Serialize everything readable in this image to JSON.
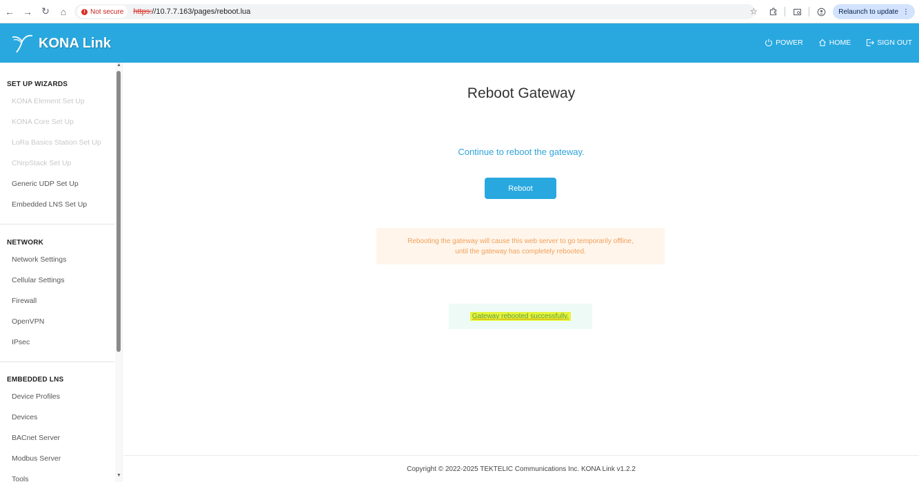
{
  "browser": {
    "security_label": "Not secure",
    "url_scheme": "https:",
    "url_rest": "//10.7.7.163/pages/reboot.lua",
    "relaunch_label": "Relaunch to update"
  },
  "header": {
    "brand": "KONA Link",
    "nav": [
      {
        "label": "POWER",
        "icon": "power-icon"
      },
      {
        "label": "HOME",
        "icon": "home-icon"
      },
      {
        "label": "SIGN OUT",
        "icon": "sign-out-icon"
      }
    ],
    "color": "#29a8e0"
  },
  "sidebar": {
    "sections": [
      {
        "title": "SET UP WIZARDS",
        "items": [
          {
            "label": "KONA Element Set Up",
            "disabled": true
          },
          {
            "label": "KONA Core Set Up",
            "disabled": true
          },
          {
            "label": "LoRa Basics Station Set Up",
            "disabled": true
          },
          {
            "label": "ChirpStack Set Up",
            "disabled": true
          },
          {
            "label": "Generic UDP Set Up",
            "disabled": false
          },
          {
            "label": "Embedded LNS Set Up",
            "disabled": false
          }
        ]
      },
      {
        "title": "NETWORK",
        "items": [
          {
            "label": "Network Settings",
            "disabled": false
          },
          {
            "label": "Cellular Settings",
            "disabled": false
          },
          {
            "label": "Firewall",
            "disabled": false
          },
          {
            "label": "OpenVPN",
            "disabled": false
          },
          {
            "label": "IPsec",
            "disabled": false
          }
        ]
      },
      {
        "title": "EMBEDDED LNS",
        "items": [
          {
            "label": "Device Profiles",
            "disabled": false
          },
          {
            "label": "Devices",
            "disabled": false
          },
          {
            "label": "BACnet Server",
            "disabled": false
          },
          {
            "label": "Modbus Server",
            "disabled": false
          },
          {
            "label": "Tools",
            "disabled": false
          }
        ]
      }
    ]
  },
  "main": {
    "title": "Reboot Gateway",
    "intro": "Continue to reboot the gateway.",
    "reboot_button": "Reboot",
    "warning_line1": "Rebooting the gateway will cause this web server to go temporarily offline,",
    "warning_line2": "until the gateway has completely rebooted.",
    "success": "Gateway rebooted successfully."
  },
  "footer": "Copyright © 2022-2025 TEKTELIC Communications Inc. KONA Link v1.2.2"
}
